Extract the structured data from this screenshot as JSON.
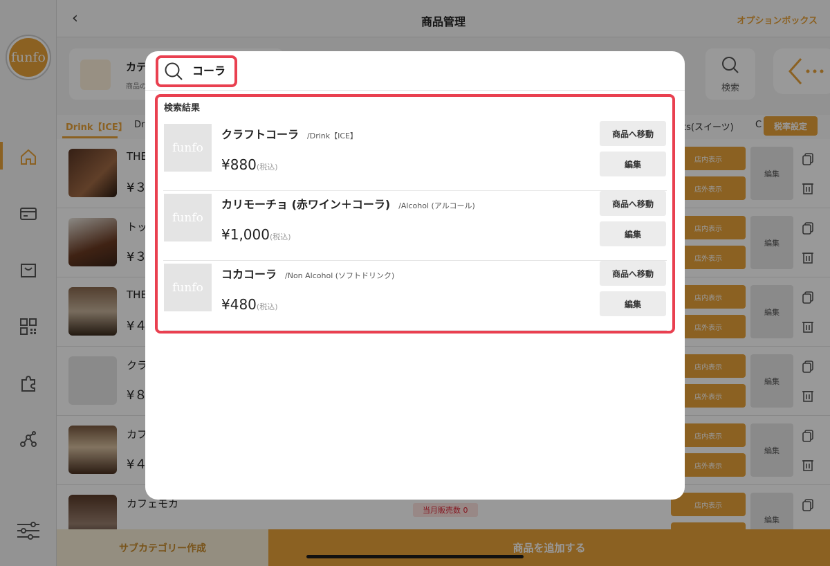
{
  "app": {
    "logo_text": "funfo"
  },
  "topbar": {
    "title": "商品管理",
    "option_link": "オプションボックス"
  },
  "category_card": {
    "title": "カテ",
    "subtitle": "商品の"
  },
  "search_card": {
    "label": "検索"
  },
  "tabs": {
    "active": "Drink【ICE】",
    "second": "Dr",
    "partial_right": "ts(スイーツ)",
    "partial_c": "C",
    "tax_button": "税率設定"
  },
  "products": [
    {
      "name": "THE",
      "price": "¥３"
    },
    {
      "name": "トッ",
      "price": "¥３"
    },
    {
      "name": "THE",
      "price": "¥４"
    },
    {
      "name": "クラ",
      "price": "¥８"
    },
    {
      "name": "カフ",
      "price": "¥４"
    },
    {
      "name": "カフェモカ",
      "price": ""
    }
  ],
  "row_buttons": {
    "in_store": "店内表示",
    "out_store": "店外表示",
    "edit": "編集"
  },
  "sales_badge": "当月販売数 0",
  "bottom": {
    "left": "サブカテゴリー作成",
    "right": "商品を追加する"
  },
  "modal": {
    "search_value": "コーラ",
    "results_title": "検索結果",
    "goto_label": "商品へ移動",
    "edit_label": "編集",
    "thumb_text": "funfo",
    "results": [
      {
        "name": "クラフトコーラ",
        "category": "/Drink【ICE】",
        "price": "¥880",
        "tax": "(税込)"
      },
      {
        "name": "カリモーチョ (赤ワイン＋コーラ)",
        "category": "/Alcohol (アルコール)",
        "price": "¥1,000",
        "tax": "(税込)"
      },
      {
        "name": "コカコーラ",
        "category": "/Non Alcohol (ソフトドリンク)",
        "price": "¥480",
        "tax": "(税込)"
      }
    ]
  }
}
